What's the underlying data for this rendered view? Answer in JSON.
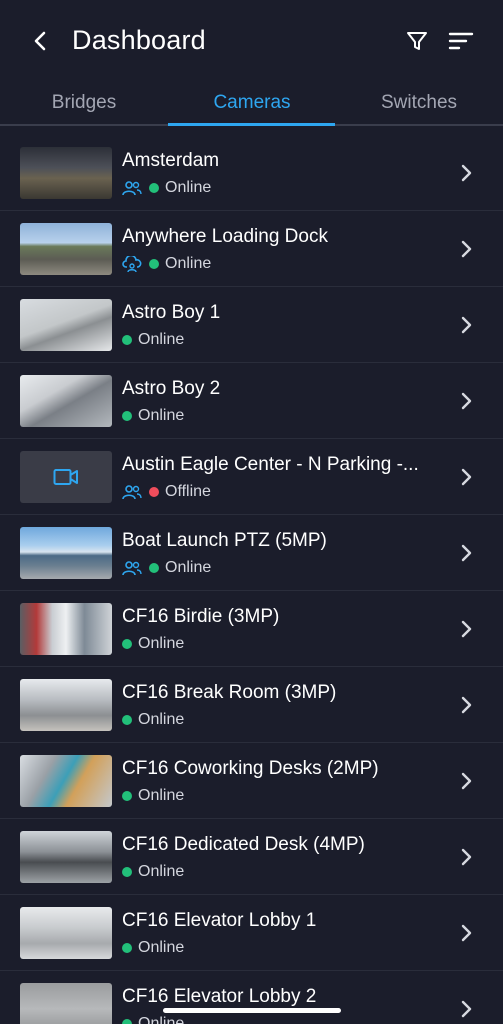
{
  "header": {
    "title": "Dashboard",
    "back_icon": "chevron-left-icon",
    "filter_icon": "filter-icon",
    "sort_icon": "sort-icon"
  },
  "tabs": [
    {
      "label": "Bridges",
      "active": false
    },
    {
      "label": "Cameras",
      "active": true
    },
    {
      "label": "Switches",
      "active": false
    }
  ],
  "colors": {
    "background": "#1b1d2b",
    "accent": "#2ea6f0",
    "online": "#22c07a",
    "offline": "#ef4d5c"
  },
  "cameras": [
    {
      "name": "Amsterdam",
      "status": "Online",
      "shared_icon": "users-icon"
    },
    {
      "name": "Anywhere Loading Dock",
      "status": "Online",
      "shared_icon": "cloud-share-icon"
    },
    {
      "name": "Astro Boy 1",
      "status": "Online",
      "shared_icon": ""
    },
    {
      "name": "Astro Boy 2",
      "status": "Online",
      "shared_icon": ""
    },
    {
      "name": "Austin Eagle Center - N Parking -...",
      "status": "Offline",
      "shared_icon": "users-icon"
    },
    {
      "name": "Boat Launch PTZ (5MP)",
      "status": "Online",
      "shared_icon": "users-icon"
    },
    {
      "name": "CF16 Birdie (3MP)",
      "status": "Online",
      "shared_icon": ""
    },
    {
      "name": "CF16 Break Room (3MP)",
      "status": "Online",
      "shared_icon": ""
    },
    {
      "name": "CF16 Coworking Desks (2MP)",
      "status": "Online",
      "shared_icon": ""
    },
    {
      "name": "CF16 Dedicated Desk (4MP)",
      "status": "Online",
      "shared_icon": ""
    },
    {
      "name": "CF16 Elevator Lobby 1",
      "status": "Online",
      "shared_icon": ""
    },
    {
      "name": "CF16 Elevator Lobby 2",
      "status": "Online",
      "shared_icon": ""
    }
  ]
}
